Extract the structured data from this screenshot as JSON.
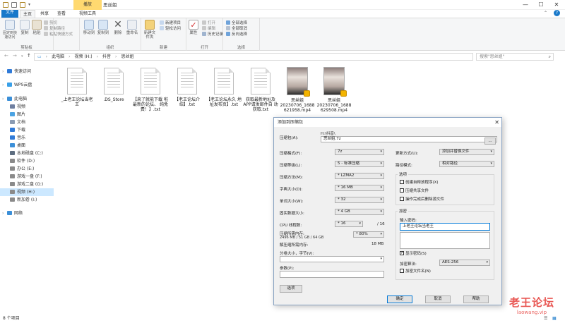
{
  "titlebar": {
    "context_tab": "播放",
    "title": "思丝姐",
    "minimize": "—",
    "maximize": "☐",
    "close": "✕"
  },
  "ribbon_tabs": [
    {
      "label": "文件"
    },
    {
      "label": "主页"
    },
    {
      "label": "共享"
    },
    {
      "label": "查看"
    },
    {
      "label": "视频工具"
    }
  ],
  "ribbon": {
    "clipboard": {
      "label": "剪贴板",
      "pin": "固定到快速访问",
      "copy": "复制",
      "paste": "粘贴",
      "cut": "剪切",
      "copy_path": "复制路径",
      "paste_shortcut": "粘贴快捷方式"
    },
    "organize": {
      "label": "组织",
      "move_to": "移动到",
      "copy_to": "复制到",
      "delete": "删除",
      "rename": "重命名"
    },
    "new": {
      "label": "新建",
      "new_folder": "新建文件夹",
      "new_item": "新建项目",
      "easy_access": "轻松访问"
    },
    "open": {
      "label": "打开",
      "properties": "属性",
      "open": "打开",
      "edit": "编辑",
      "history": "历史记录"
    },
    "select": {
      "label": "选择",
      "select_all": "全部选择",
      "select_none": "全部取消",
      "invert": "反向选择"
    }
  },
  "address": {
    "back": "←",
    "forward": "→",
    "up": "↑",
    "crumbs": [
      "此电脑",
      "视频 (H:)",
      "抖音",
      "思丝姐"
    ],
    "search_placeholder": "搜索\"思丝姐\""
  },
  "nav": [
    {
      "label": "快速访问",
      "icon": "star-icon",
      "color": "#2f7ad8",
      "depth": 0
    },
    {
      "label": "WPS云盘",
      "icon": "cloud-icon",
      "color": "#3aa0e8",
      "depth": 0
    },
    {
      "label": "此电脑",
      "icon": "computer-icon",
      "color": "#3b8fd8",
      "depth": 0
    },
    {
      "label": "视频",
      "icon": "video-icon",
      "color": "#6f7fa0",
      "depth": 1
    },
    {
      "label": "图片",
      "icon": "picture-icon",
      "color": "#4ba3e3",
      "depth": 1
    },
    {
      "label": "文档",
      "icon": "document-icon",
      "color": "#8a9bb3",
      "depth": 1
    },
    {
      "label": "下载",
      "icon": "download-icon",
      "color": "#2f7ad8",
      "depth": 1
    },
    {
      "label": "音乐",
      "icon": "music-icon",
      "color": "#2f7ad8",
      "depth": 1
    },
    {
      "label": "桌面",
      "icon": "desktop-icon",
      "color": "#3b8fd8",
      "depth": 1
    },
    {
      "label": "本地磁盘 (C:)",
      "icon": "drive-icon",
      "color": "#5d6d80",
      "depth": 1
    },
    {
      "label": "软件 (D:)",
      "icon": "drive-icon",
      "color": "#8a8a8a",
      "depth": 1
    },
    {
      "label": "办公 (E:)",
      "icon": "drive-icon",
      "color": "#8a8a8a",
      "depth": 1
    },
    {
      "label": "游戏一盘 (F:)",
      "icon": "drive-icon",
      "color": "#8a8a8a",
      "depth": 1
    },
    {
      "label": "游戏二盘 (G:)",
      "icon": "drive-icon",
      "color": "#8a8a8a",
      "depth": 1
    },
    {
      "label": "视频 (H:)",
      "icon": "drive-icon",
      "color": "#8a8a8a",
      "depth": 1,
      "selected": true
    },
    {
      "label": "新加卷 (I:)",
      "icon": "drive-icon",
      "color": "#8a8a8a",
      "depth": 1
    },
    {
      "label": "网络",
      "icon": "network-icon",
      "color": "#3b8fd8",
      "depth": 0
    }
  ],
  "files": [
    {
      "name": "_上老王论坛当老王",
      "kind": "doc"
    },
    {
      "name": ".DS_Store",
      "kind": "doc"
    },
    {
      "name": "【来了就能下载 啦最新的论坛、 纯免费！】.txt",
      "kind": "doc"
    },
    {
      "name": "【老王论坛介 绍】.txt",
      "kind": "doc"
    },
    {
      "name": "【老王论坛永久 地址发布页】.txt",
      "kind": "doc"
    },
    {
      "name": "获取最新地址及 APP请发邮件自 动获取.txt",
      "kind": "doc"
    },
    {
      "name": "思丝姐 20230706_1688 621958.mp4",
      "kind": "video"
    },
    {
      "name": "思丝姐 20230706_1688 629508.mp4",
      "kind": "video"
    }
  ],
  "status": "8 个项目",
  "dialog": {
    "title": "添加到压缩包",
    "close": "✕",
    "archive_label": "压缩包(A):",
    "archive_path": "H:\\抖音\\",
    "archive_name": "思丝姐.7z",
    "browse": "...",
    "left": [
      {
        "label": "压缩格式(F):",
        "value": "7z"
      },
      {
        "label": "压缩等级(L):",
        "value": "5 - 标准压缩"
      },
      {
        "label": "压缩方法(M):",
        "value": "* LZMA2"
      },
      {
        "label": "字典大小(D):",
        "value": "* 16 MB"
      },
      {
        "label": "单词大小(W):",
        "value": "* 32"
      },
      {
        "label": "固实数据大小:",
        "value": "* 4 GB"
      }
    ],
    "cpu_label": "CPU 线程数:",
    "cpu_value": "* 16",
    "cpu_total": "/ 16",
    "mem_label": "压缩所需内存:",
    "mem_detail": "2496 MB / 51 GB / 64 GB",
    "mem_percent": "* 80%",
    "decomp_label": "解压缩所需内存:",
    "decomp_value": "18 MB",
    "split_label": "分卷大小，字节(V):",
    "params_label": "参数(P):",
    "options_btn": "选项",
    "right": [
      {
        "label": "更新方式(U):",
        "value": "添加并替换文件"
      },
      {
        "label": "路径模式:",
        "value": "相对路径"
      }
    ],
    "options_group": "选项",
    "options": [
      {
        "label": "创建自释放程序(X)",
        "checked": false
      },
      {
        "label": "压缩共享文件",
        "checked": false
      },
      {
        "label": "操作完成后删除源文件",
        "checked": false
      }
    ],
    "encrypt_group": "加密",
    "password_label": "输入密码:",
    "password_value": "上老王论坛当老王",
    "show_password": "显示密码(S)",
    "method_label": "加密算法:",
    "method_value": "AES-256",
    "encrypt_names": "加密文件名(N)",
    "ok": "确定",
    "cancel": "取消",
    "help": "帮助"
  },
  "watermark": {
    "main": "老王论坛",
    "sub": "laowang.vip"
  }
}
